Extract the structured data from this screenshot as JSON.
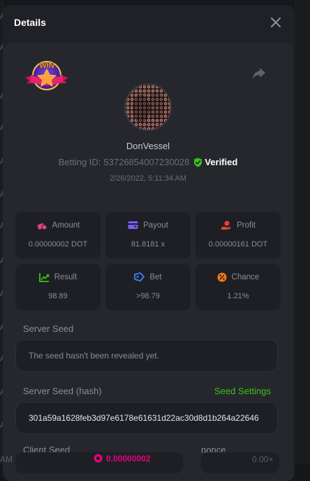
{
  "modal": {
    "title": "Details"
  },
  "player": {
    "name": "DonVessel",
    "betting_id_label": "Betting ID:",
    "betting_id": "537268540072300​28",
    "verified_label": "Verified",
    "timestamp": "2/26/2022, 5:11:34 AM"
  },
  "badge": {
    "text": "WIN"
  },
  "stats": [
    {
      "label": "Amount",
      "value": "0.00000002 DOT",
      "icon": "coins-icon",
      "color": "#e0457b"
    },
    {
      "label": "Payout",
      "value": "81.8181 x",
      "icon": "wallet-icon",
      "color": "#7c5cf5"
    },
    {
      "label": "Profit",
      "value": "0.00000161 DOT",
      "icon": "hand-coin-icon",
      "color": "#e0453a"
    },
    {
      "label": "Result",
      "value": "98.89",
      "icon": "chart-up-icon",
      "color": "#3bc117"
    },
    {
      "label": "Bet",
      "value": ">98.79",
      "icon": "ticket-icon",
      "color": "#3b82f6"
    },
    {
      "label": "Chance",
      "value": "1.21%",
      "icon": "percent-icon",
      "color": "#f07a1a"
    }
  ],
  "server_seed": {
    "label": "Server Seed",
    "value": "The seed hasn't been revealed yet."
  },
  "server_seed_hash": {
    "label": "Server Seed (hash)",
    "settings_link": "Seed Settings",
    "value": "301a59a1628feb3d97e6178e61631d22ac30d8d1b264a22646"
  },
  "client_seed": {
    "label": "Client Seed"
  },
  "nonce": {
    "label": "nonce"
  },
  "background": {
    "amount_fragment": "0.00000002",
    "multiplier_fragment": "0.00×",
    "left_letters": [
      "A",
      "A",
      "A",
      "A",
      "A",
      "A",
      "A",
      "A",
      "A",
      "A",
      "A",
      "A",
      "A"
    ],
    "am_fragment": "AM"
  },
  "colors": {
    "accent_green": "#3bc117",
    "panel": "#26272c",
    "card": "#1e1f24"
  }
}
